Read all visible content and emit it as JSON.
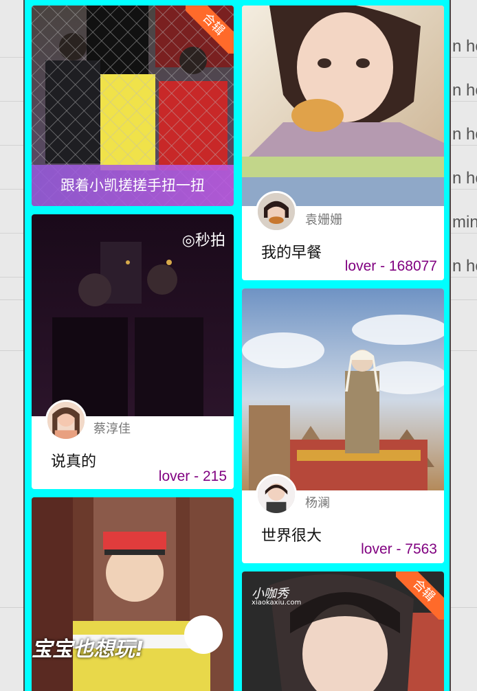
{
  "background": {
    "row_texts": [
      "n ho",
      "n ho",
      "n ho",
      "n ho",
      "min",
      "n ho"
    ]
  },
  "feed": {
    "left": [
      {
        "caption": "跟着小凯搓搓手扭一扭",
        "ribbon": "合辑",
        "colors": {
          "top": "#3a3a3a",
          "bottom": "#5b4a6b"
        }
      },
      {
        "author": "蔡淳佳",
        "title": "说真的",
        "likes": "lover - 215",
        "watermark": "◎秒拍",
        "colors": {
          "top": "#1a0a1a",
          "bottom": "#2b142a"
        }
      },
      {
        "overlay_text": "宝宝也想玩!",
        "colors": {
          "top": "#6b3a2c",
          "bottom": "#d7c24a"
        }
      }
    ],
    "right": [
      {
        "author": "袁姗姗",
        "title": "我的早餐",
        "likes": "lover - 168077",
        "colors": {
          "top": "#f1e8dc",
          "bottom": "#c9b08e"
        }
      },
      {
        "author": "杨澜",
        "title": "世界很大",
        "likes": "lover - 7563",
        "colors": {
          "top": "#9db7d8",
          "bottom": "#8f6e4a"
        }
      },
      {
        "ribbon": "合辑",
        "logo": "小咖秀",
        "logo_sub": "xiaokaxiu.com",
        "colors": {
          "top": "#2a2a2a",
          "bottom": "#b84a3a"
        }
      }
    ]
  },
  "theme": {
    "panel": "#00ffff",
    "likes": "#800080",
    "ribbon": "#ff6a2a"
  }
}
